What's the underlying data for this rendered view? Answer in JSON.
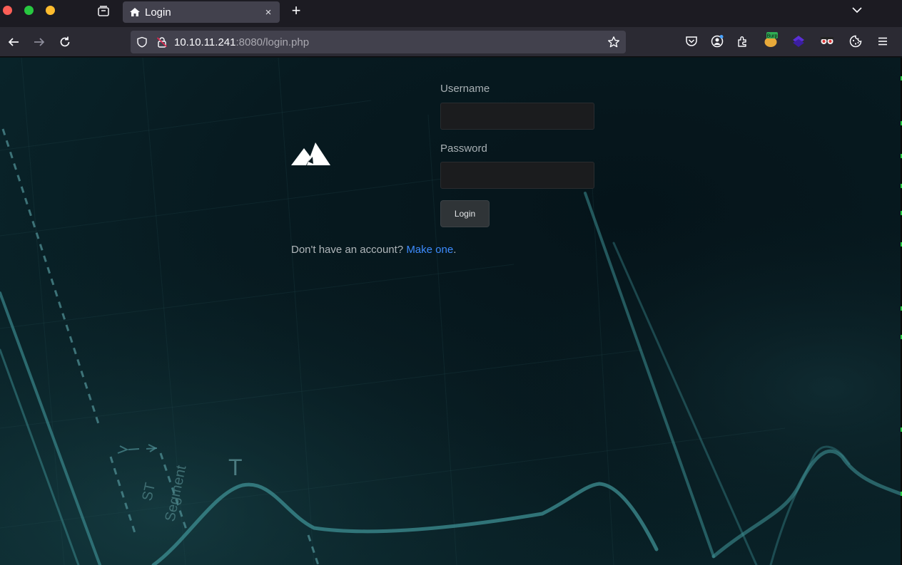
{
  "browser": {
    "tab_title": "Login",
    "tab_close": "×",
    "new_tab": "+",
    "url_host": "10.10.11.241",
    "url_rest": ":8080/login.php"
  },
  "extensions": [
    "pocket-icon",
    "firefox-account-icon",
    "extensions-icon",
    "burp-icon",
    "hacktools-icon",
    "foxyproxy-icon",
    "cookie-editor-icon",
    "menu-icon"
  ],
  "burp_badge": "Burp",
  "form": {
    "username_label": "Username",
    "username_value": "",
    "password_label": "Password",
    "password_value": "",
    "login_label": "Login"
  },
  "signup": {
    "prefix": "Don't have an account? ",
    "link": "Make one",
    "suffix": "."
  },
  "background_labels": {
    "t_wave": "T",
    "st_segment_1": "ST",
    "st_segment_2": "Segment"
  },
  "colors": {
    "link": "#3d8bfd",
    "page_bg": "#071a20",
    "ecg_line": "#3d8f93"
  }
}
